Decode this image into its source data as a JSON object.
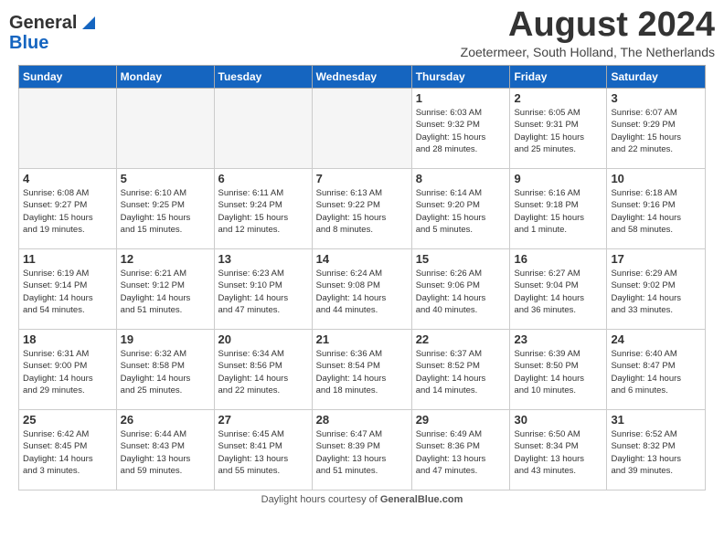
{
  "header": {
    "logo_line1": "General",
    "logo_line2": "Blue",
    "month_year": "August 2024",
    "location": "Zoetermeer, South Holland, The Netherlands"
  },
  "weekdays": [
    "Sunday",
    "Monday",
    "Tuesday",
    "Wednesday",
    "Thursday",
    "Friday",
    "Saturday"
  ],
  "weeks": [
    [
      {
        "day": "",
        "info": ""
      },
      {
        "day": "",
        "info": ""
      },
      {
        "day": "",
        "info": ""
      },
      {
        "day": "",
        "info": ""
      },
      {
        "day": "1",
        "info": "Sunrise: 6:03 AM\nSunset: 9:32 PM\nDaylight: 15 hours\nand 28 minutes."
      },
      {
        "day": "2",
        "info": "Sunrise: 6:05 AM\nSunset: 9:31 PM\nDaylight: 15 hours\nand 25 minutes."
      },
      {
        "day": "3",
        "info": "Sunrise: 6:07 AM\nSunset: 9:29 PM\nDaylight: 15 hours\nand 22 minutes."
      }
    ],
    [
      {
        "day": "4",
        "info": "Sunrise: 6:08 AM\nSunset: 9:27 PM\nDaylight: 15 hours\nand 19 minutes."
      },
      {
        "day": "5",
        "info": "Sunrise: 6:10 AM\nSunset: 9:25 PM\nDaylight: 15 hours\nand 15 minutes."
      },
      {
        "day": "6",
        "info": "Sunrise: 6:11 AM\nSunset: 9:24 PM\nDaylight: 15 hours\nand 12 minutes."
      },
      {
        "day": "7",
        "info": "Sunrise: 6:13 AM\nSunset: 9:22 PM\nDaylight: 15 hours\nand 8 minutes."
      },
      {
        "day": "8",
        "info": "Sunrise: 6:14 AM\nSunset: 9:20 PM\nDaylight: 15 hours\nand 5 minutes."
      },
      {
        "day": "9",
        "info": "Sunrise: 6:16 AM\nSunset: 9:18 PM\nDaylight: 15 hours\nand 1 minute."
      },
      {
        "day": "10",
        "info": "Sunrise: 6:18 AM\nSunset: 9:16 PM\nDaylight: 14 hours\nand 58 minutes."
      }
    ],
    [
      {
        "day": "11",
        "info": "Sunrise: 6:19 AM\nSunset: 9:14 PM\nDaylight: 14 hours\nand 54 minutes."
      },
      {
        "day": "12",
        "info": "Sunrise: 6:21 AM\nSunset: 9:12 PM\nDaylight: 14 hours\nand 51 minutes."
      },
      {
        "day": "13",
        "info": "Sunrise: 6:23 AM\nSunset: 9:10 PM\nDaylight: 14 hours\nand 47 minutes."
      },
      {
        "day": "14",
        "info": "Sunrise: 6:24 AM\nSunset: 9:08 PM\nDaylight: 14 hours\nand 44 minutes."
      },
      {
        "day": "15",
        "info": "Sunrise: 6:26 AM\nSunset: 9:06 PM\nDaylight: 14 hours\nand 40 minutes."
      },
      {
        "day": "16",
        "info": "Sunrise: 6:27 AM\nSunset: 9:04 PM\nDaylight: 14 hours\nand 36 minutes."
      },
      {
        "day": "17",
        "info": "Sunrise: 6:29 AM\nSunset: 9:02 PM\nDaylight: 14 hours\nand 33 minutes."
      }
    ],
    [
      {
        "day": "18",
        "info": "Sunrise: 6:31 AM\nSunset: 9:00 PM\nDaylight: 14 hours\nand 29 minutes."
      },
      {
        "day": "19",
        "info": "Sunrise: 6:32 AM\nSunset: 8:58 PM\nDaylight: 14 hours\nand 25 minutes."
      },
      {
        "day": "20",
        "info": "Sunrise: 6:34 AM\nSunset: 8:56 PM\nDaylight: 14 hours\nand 22 minutes."
      },
      {
        "day": "21",
        "info": "Sunrise: 6:36 AM\nSunset: 8:54 PM\nDaylight: 14 hours\nand 18 minutes."
      },
      {
        "day": "22",
        "info": "Sunrise: 6:37 AM\nSunset: 8:52 PM\nDaylight: 14 hours\nand 14 minutes."
      },
      {
        "day": "23",
        "info": "Sunrise: 6:39 AM\nSunset: 8:50 PM\nDaylight: 14 hours\nand 10 minutes."
      },
      {
        "day": "24",
        "info": "Sunrise: 6:40 AM\nSunset: 8:47 PM\nDaylight: 14 hours\nand 6 minutes."
      }
    ],
    [
      {
        "day": "25",
        "info": "Sunrise: 6:42 AM\nSunset: 8:45 PM\nDaylight: 14 hours\nand 3 minutes."
      },
      {
        "day": "26",
        "info": "Sunrise: 6:44 AM\nSunset: 8:43 PM\nDaylight: 13 hours\nand 59 minutes."
      },
      {
        "day": "27",
        "info": "Sunrise: 6:45 AM\nSunset: 8:41 PM\nDaylight: 13 hours\nand 55 minutes."
      },
      {
        "day": "28",
        "info": "Sunrise: 6:47 AM\nSunset: 8:39 PM\nDaylight: 13 hours\nand 51 minutes."
      },
      {
        "day": "29",
        "info": "Sunrise: 6:49 AM\nSunset: 8:36 PM\nDaylight: 13 hours\nand 47 minutes."
      },
      {
        "day": "30",
        "info": "Sunrise: 6:50 AM\nSunset: 8:34 PM\nDaylight: 13 hours\nand 43 minutes."
      },
      {
        "day": "31",
        "info": "Sunrise: 6:52 AM\nSunset: 8:32 PM\nDaylight: 13 hours\nand 39 minutes."
      }
    ]
  ],
  "footer": {
    "label": "Daylight hours",
    "url_label": "GeneralBlue.com"
  }
}
